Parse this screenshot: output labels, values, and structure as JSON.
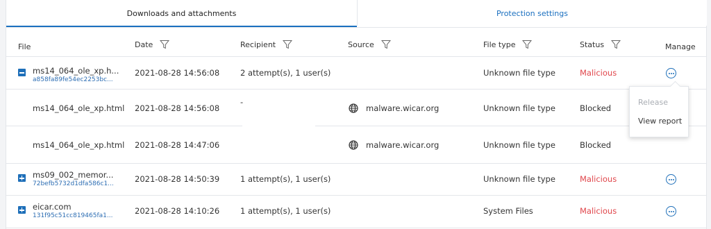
{
  "tabs": {
    "downloads": "Downloads and attachments",
    "protection": "Protection settings"
  },
  "columns": {
    "file": "File",
    "date": "Date",
    "recipient": "Recipient",
    "source": "Source",
    "file_type": "File type",
    "status": "Status",
    "manage": "Manage"
  },
  "rows": [
    {
      "file": "ms14_064_ole_xp.h...",
      "hash": "a858fa89fe54ec2253bc...",
      "date": "2021-08-28 14:56:08",
      "recipient": "2 attempt(s), 1 user(s)",
      "source": "",
      "file_type": "Unknown file type",
      "status": "Malicious",
      "expanded": true
    },
    {
      "file": "ms14_064_ole_xp.html",
      "date": "2021-08-28 14:56:08",
      "recipient": "-",
      "source": "malware.wicar.org",
      "file_type": "Unknown file type",
      "status": "Blocked"
    },
    {
      "file": "ms14_064_ole_xp.html",
      "date": "2021-08-28 14:47:06",
      "recipient": "",
      "source": "malware.wicar.org",
      "file_type": "Unknown file type",
      "status": "Blocked"
    },
    {
      "file": "ms09_002_memor...",
      "hash": "72befb5732d1dfa586c1...",
      "date": "2021-08-28 14:50:39",
      "recipient": "1 attempt(s), 1 user(s)",
      "source": "",
      "file_type": "Unknown file type",
      "status": "Malicious",
      "expanded": false
    },
    {
      "file": "eicar.com",
      "hash": "131f95c51cc819465fa1...",
      "date": "2021-08-28 14:10:26",
      "recipient": "1 attempt(s), 1 user(s)",
      "source": "",
      "file_type": "System Files",
      "status": "Malicious",
      "expanded": false
    }
  ],
  "menu": {
    "release": "Release",
    "view_report": "View report"
  },
  "colors": {
    "accent": "#1e6fb9",
    "malicious": "#e0464b",
    "disabled": "#a9adb3"
  }
}
